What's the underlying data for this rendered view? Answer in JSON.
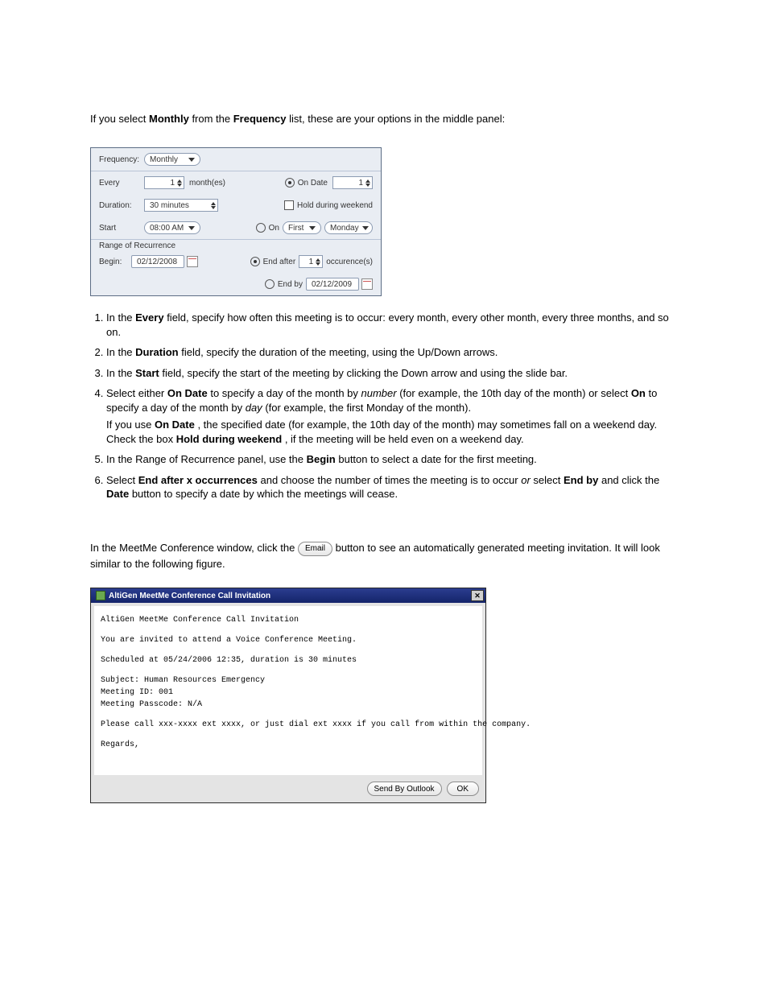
{
  "intro": {
    "p1a": "If you select ",
    "p1_bold1": "Monthly",
    "p1b": " from the ",
    "p1_bold2": "Frequency",
    "p1c": " list, these are your options in the middle panel:"
  },
  "fig1": {
    "labels": {
      "frequency": "Frequency:",
      "every": "Every",
      "monthes": "month(es)",
      "duration": "Duration:",
      "start": "Start",
      "ror": "Range of Recurrence",
      "begin": "Begin:",
      "on_date": "On Date",
      "hold_weekend": "Hold during weekend",
      "on": "On",
      "end_after": "End after",
      "occurences": "occurence(s)",
      "end_by": "End by"
    },
    "values": {
      "frequency": "Monthly",
      "every": "1",
      "on_date": "1",
      "duration": "30 minutes",
      "start": "08:00 AM",
      "begin": "02/12/2008",
      "ordinal": "First",
      "day": "Monday",
      "end_after": "1",
      "end_by": "02/12/2009"
    }
  },
  "steps": {
    "s1a": "In the ",
    "s1_bold": "Every",
    "s1b": " field, specify how often this meeting is to occur: every month, every other month, every three months, and so on.",
    "s2a": "In the ",
    "s2_bold": "Duration",
    "s2b": " field, specify the duration of the meeting, using the Up/Down arrows.",
    "s3a": "In the ",
    "s3_bold": "Start",
    "s3b": " field, specify the start of the meeting by clicking the Down arrow and using the slide bar.",
    "s4a": "Select either ",
    "s4_bold1": "On Date",
    "s4b": " to specify a day of the month by ",
    "s4_ital1": "number",
    "s4c": " (for example, the 10th day of the month) or select ",
    "s4_bold2": "On",
    "s4d": " to specify a day of the month by ",
    "s4_ital2": "day",
    "s4e": " (for example, the first Monday of the month).",
    "s4_sub_a": "If you use ",
    "s4_sub_bold1": "On Date",
    "s4_sub_b": ", the specified date (for example, the 10th day of the month) may sometimes fall on a weekend day. Check the box ",
    "s4_sub_bold2": "Hold during weekend",
    "s4_sub_c": ", if the meeting will be held even on a weekend day.",
    "s5a": "In the Range of Recurrence panel, use the ",
    "s5_bold": "Begin",
    "s5b": " button to select a date for the first meeting.",
    "s6a": "Select ",
    "s6_bold1": "End after x occurrences",
    "s6b": " and choose the number of times the meeting is to occur ",
    "s6_ital": "or",
    "s6c": " select ",
    "s6_bold2": "End by",
    "s6d": " and click the ",
    "s6_bold3": "Date",
    "s6e": " button to specify a date by which the meetings will cease."
  },
  "email_section": {
    "p1a": "In the MeetMe Conference window, click the ",
    "btn": "Email",
    "p1b": " button to see an automatically generated meeting invitation. It will look similar to the following figure."
  },
  "fig2": {
    "title": "AltiGen MeetMe Conference Call Invitation",
    "line1": "AltiGen MeetMe Conference Call Invitation",
    "line2": "You are invited to attend a Voice Conference Meeting.",
    "line3": "Scheduled at 05/24/2006 12:35, duration is 30 minutes",
    "line4": "Subject: Human Resources Emergency",
    "line5": "Meeting ID: 001",
    "line6": "Meeting Passcode: N/A",
    "line7": "Please call xxx-xxxx ext xxxx, or just dial ext xxxx if you call from within the company.",
    "line8": "Regards,",
    "send_btn": "Send By Outlook",
    "ok_btn": "OK"
  }
}
